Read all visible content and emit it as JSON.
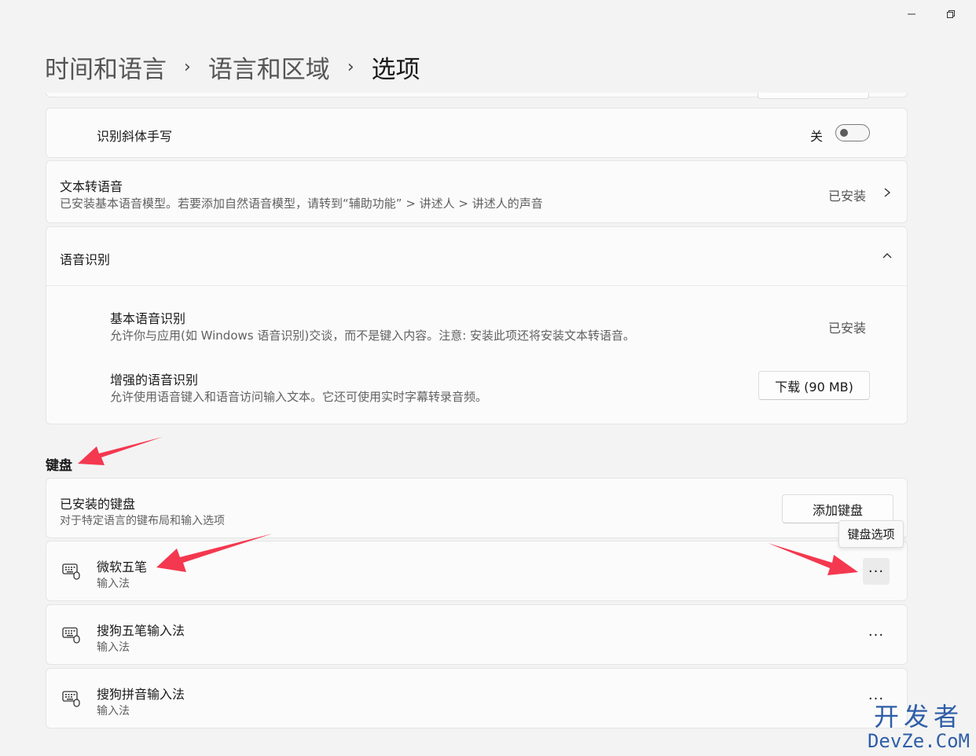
{
  "window": {
    "minimize_icon": "minimize-icon",
    "restore_icon": "restore-icon"
  },
  "breadcrumb": {
    "item1": "时间和语言",
    "item2": "语言和区域",
    "current": "选项"
  },
  "handwriting_italic": {
    "label": "识别斜体手写",
    "state": "关"
  },
  "tts": {
    "title": "文本转语音",
    "description": "已安装基本语音模型。若要添加自然语音模型，请转到“辅助功能” > 讲述人 > 讲述人的声音",
    "status": "已安装"
  },
  "speech_recognition": {
    "title": "语音识别",
    "basic": {
      "title": "基本语音识别",
      "description": "允许你与应用(如 Windows 语音识别)交谈，而不是键入内容。注意: 安装此项还将安装文本转语音。",
      "status": "已安装"
    },
    "enhanced": {
      "title": "增强的语音识别",
      "description": "允许使用语音键入和语音访问输入文本。它还可使用实时字幕转录音频。",
      "button": "下载 (90 MB)"
    }
  },
  "keyboard_section": {
    "heading": "键盘",
    "installed": {
      "title": "已安装的键盘",
      "description": "对于特定语言的键布局和输入选项",
      "add_button": "添加键盘"
    },
    "tooltip": "键盘选项",
    "items": [
      {
        "name": "微软五笔",
        "type": "输入法",
        "more": "···"
      },
      {
        "name": "搜狗五笔输入法",
        "type": "输入法",
        "more": "···"
      },
      {
        "name": "搜狗拼音输入法",
        "type": "输入法",
        "more": "···"
      }
    ]
  },
  "watermark": {
    "line1": "开发者",
    "line2": "DevZe.CoM"
  },
  "colors": {
    "background": "#f3f3f3",
    "card": "#fbfbfb",
    "annotation_arrow": "#f4384f"
  }
}
